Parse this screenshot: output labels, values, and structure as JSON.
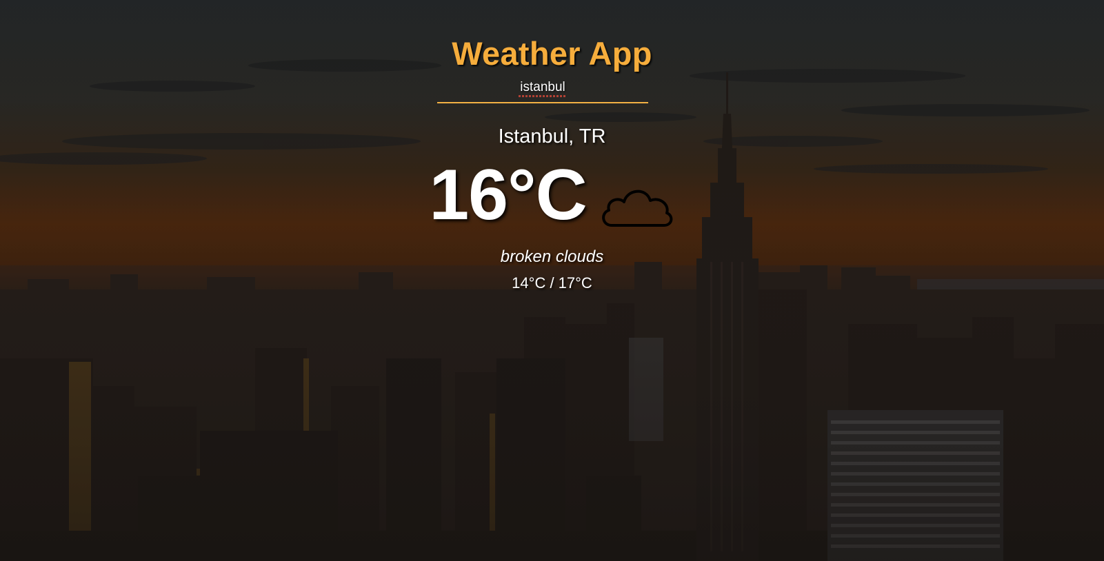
{
  "app": {
    "title": "Weather App"
  },
  "search": {
    "value": "istanbul"
  },
  "weather": {
    "location": "Istanbul, TR",
    "temperature": "16°C",
    "condition_icon": "cloud-icon",
    "description": "broken clouds",
    "range": "14°C / 17°C"
  },
  "colors": {
    "accent": "#f6ad3c",
    "underline": "#f3b144",
    "text": "#ffffff",
    "sky_top": "#2f3334",
    "horizon": "#7a3a0c"
  },
  "background": {
    "image": "city-skyline-sunset"
  }
}
